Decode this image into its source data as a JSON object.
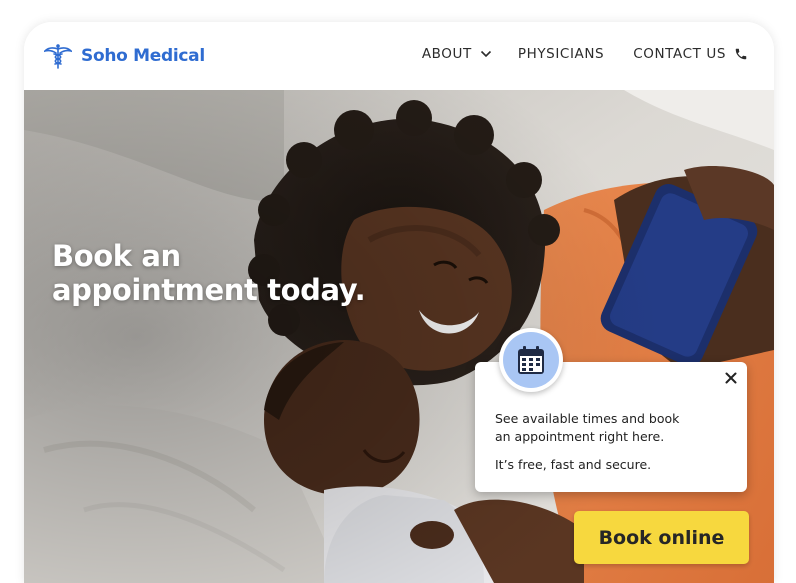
{
  "brand": {
    "name": "Soho Medical",
    "color": "#2f6cd1",
    "icon": "caduceus-icon"
  },
  "nav": {
    "about": "ABOUT",
    "physicians": "PHYSICIANS",
    "contact": "CONTACT US",
    "about_icon": "chevron-down-icon",
    "contact_icon": "phone-icon"
  },
  "hero": {
    "headline_line1": "Book an",
    "headline_line2": "appointment today."
  },
  "popup": {
    "icon": "calendar-icon",
    "line1": "See available times and book",
    "line2": "an appointment right here.",
    "line3": "It’s free, fast and secure.",
    "close_icon": "close-icon"
  },
  "cta": {
    "label": "Book online",
    "color": "#f7d83e"
  }
}
